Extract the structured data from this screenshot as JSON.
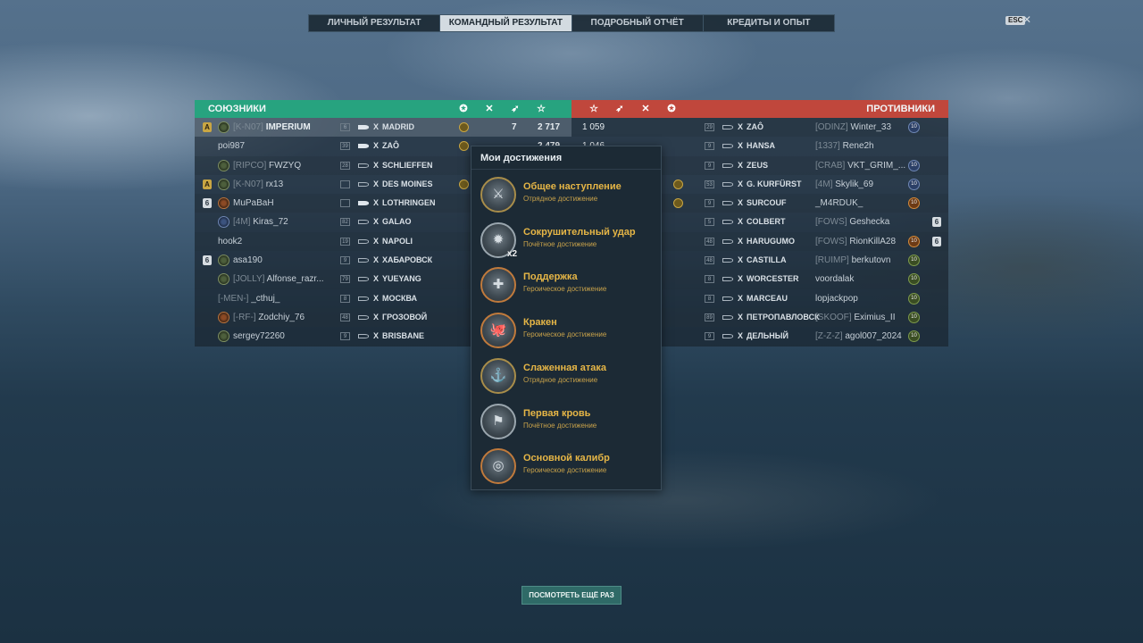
{
  "tabs": [
    "ЛИЧНЫЙ РЕЗУЛЬТАТ",
    "КОМАНДНЫЙ РЕЗУЛЬТАТ",
    "ПОДРОБНЫЙ ОТЧЁТ",
    "КРЕДИТЫ И ОПЫТ"
  ],
  "active_tab": "КОМАНДНЫЙ РЕЗУЛЬТАТ",
  "esc_label": "ESC",
  "close_glyph": "✕",
  "allies": {
    "title": "СОЮЗНИКИ",
    "columns": [
      "rank-icon",
      "frags-icon",
      "planes-icon",
      "score-icon"
    ],
    "players": [
      {
        "badge": "A",
        "clan": "[K-N07]",
        "name": "IMPERIUM",
        "tier": "6",
        "ship": "MADRID",
        "frags": "7",
        "score": "2 717"
      },
      {
        "badge": "",
        "clan": "",
        "name": "poi987",
        "tier": "39",
        "ship": "ZAÔ",
        "frags": "",
        "score": "2 479"
      },
      {
        "badge": "",
        "clan": "[RIPCO]",
        "name": "FWZYQ",
        "tier": "28",
        "ship": "SCHLIEFFEN",
        "frags": "",
        "score": ""
      },
      {
        "badge": "A",
        "clan": "[K-N07]",
        "name": "rx13",
        "tier": "",
        "ship": "DES MOINES",
        "frags": "",
        "score": ""
      },
      {
        "badge": "6",
        "clan": "",
        "name": "MuPaBaH",
        "tier": "",
        "ship": "LOTHRINGEN",
        "frags": "",
        "score": ""
      },
      {
        "badge": "",
        "clan": "[4M]",
        "name": "Kiras_72",
        "tier": "82",
        "ship": "GALAO",
        "frags": "",
        "score": ""
      },
      {
        "badge": "",
        "clan": "",
        "name": "hook2",
        "tier": "19",
        "ship": "NAPOLI",
        "frags": "",
        "score": ""
      },
      {
        "badge": "6",
        "clan": "",
        "name": "asa190",
        "tier": "9",
        "ship": "ХАБАРОВСК",
        "frags": "",
        "score": ""
      },
      {
        "badge": "",
        "clan": "[JOLLY]",
        "name": "Alfonse_razr...",
        "tier": "79",
        "ship": "YUEYANG",
        "frags": "",
        "score": ""
      },
      {
        "badge": "",
        "clan": "[-MEN-]",
        "name": "_cthuj_",
        "tier": "8",
        "ship": "МОСКВА",
        "frags": "",
        "score": ""
      },
      {
        "badge": "",
        "clan": "[-RF-]",
        "name": "Zodchiy_76",
        "tier": "48",
        "ship": "ГРОЗОВОЙ",
        "frags": "",
        "score": ""
      },
      {
        "badge": "",
        "clan": "",
        "name": "sergey72260",
        "tier": "9",
        "ship": "BRISBANE",
        "frags": "",
        "score": ""
      }
    ]
  },
  "enemies": {
    "title": "ПРОТИВНИКИ",
    "columns": [
      "score-icon",
      "planes-icon",
      "frags-icon",
      "rank-icon"
    ],
    "players": [
      {
        "score": "1 059",
        "tier": "29",
        "ship": "ZAÔ",
        "clan": "[ODINZ]",
        "name": "Winter_33",
        "lvl": "10",
        "badge": ""
      },
      {
        "score": "1 046",
        "tier": "9",
        "ship": "HANSA",
        "clan": "[1337]",
        "name": "Rene2h",
        "lvl": "",
        "badge": ""
      },
      {
        "score": "",
        "tier": "9",
        "ship": "ZEUS",
        "clan": "[CRAB]",
        "name": "VKT_GRIM_...",
        "lvl": "10",
        "badge": ""
      },
      {
        "score": "",
        "tier": "53",
        "ship": "G. KURFÜRST",
        "clan": "[4M]",
        "name": "Skylik_69",
        "lvl": "10",
        "badge": ""
      },
      {
        "score": "",
        "tier": "9",
        "ship": "SURCOUF",
        "clan": "",
        "name": "_M4RDUK_",
        "lvl": "10",
        "badge": ""
      },
      {
        "score": "",
        "tier": "5",
        "ship": "COLBERT",
        "clan": "[FOWS]",
        "name": "Geshecka",
        "lvl": "",
        "badge": "6"
      },
      {
        "score": "",
        "tier": "48",
        "ship": "HARUGUMO",
        "clan": "[FOWS]",
        "name": "RionKillA28",
        "lvl": "10",
        "badge": "6"
      },
      {
        "score": "",
        "tier": "48",
        "ship": "CASTILLA",
        "clan": "[RUIMP]",
        "name": "berkutovn",
        "lvl": "10",
        "badge": ""
      },
      {
        "score": "",
        "tier": "8",
        "ship": "WORCESTER",
        "clan": "",
        "name": "voordalak",
        "lvl": "10",
        "badge": ""
      },
      {
        "score": "",
        "tier": "8",
        "ship": "MARCEAU",
        "clan": "",
        "name": "lopjackpop",
        "lvl": "10",
        "badge": ""
      },
      {
        "score": "",
        "tier": "89",
        "ship": "ПЕТРОПАВЛОВСК",
        "clan": "[SKOOF]",
        "name": "Eximius_II",
        "lvl": "10",
        "badge": ""
      },
      {
        "score": "",
        "tier": "9",
        "ship": "ДЕЛЬНЫЙ",
        "clan": "[Z-Z-Z]",
        "name": "agol007_2024",
        "lvl": "10",
        "badge": ""
      }
    ]
  },
  "ship_tier_prefix": "X",
  "achievements": {
    "title": "Мои достижения",
    "items": [
      {
        "name": "Общее наступление",
        "type": "Отрядное достижение",
        "kind": "team",
        "mult": ""
      },
      {
        "name": "Сокрушительный удар",
        "type": "Почётное достижение",
        "kind": "honor",
        "mult": "x2"
      },
      {
        "name": "Поддержка",
        "type": "Героическое достижение",
        "kind": "hero",
        "mult": ""
      },
      {
        "name": "Кракен",
        "type": "Героическое достижение",
        "kind": "hero",
        "mult": ""
      },
      {
        "name": "Слаженная атака",
        "type": "Отрядное достижение",
        "kind": "team",
        "mult": ""
      },
      {
        "name": "Первая кровь",
        "type": "Почётное достижение",
        "kind": "honor",
        "mult": ""
      },
      {
        "name": "Основной калибр",
        "type": "Героическое достижение",
        "kind": "hero",
        "mult": ""
      }
    ]
  },
  "replay_button": "ПОСМОТРЕТЬ ЕЩЁ РАЗ"
}
